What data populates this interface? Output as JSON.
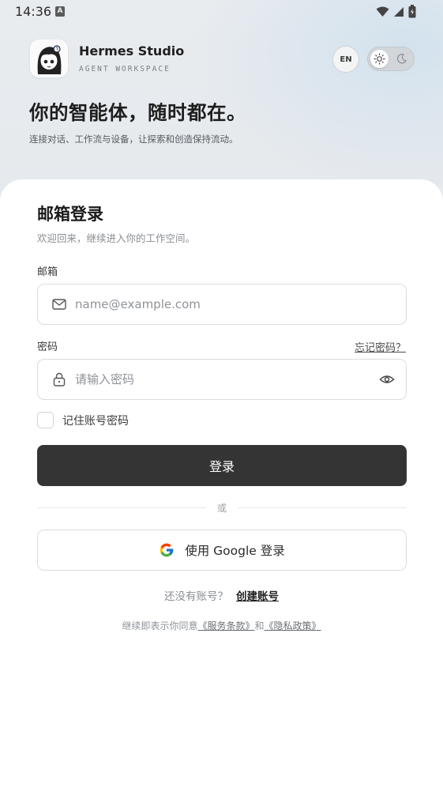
{
  "status_bar": {
    "time": "14:36",
    "notification_glyph": "A"
  },
  "brand": {
    "name": "Hermes Studio",
    "subtitle": "AGENT WORKSPACE"
  },
  "header": {
    "language_button": "EN"
  },
  "hero": {
    "title": "你的智能体，随时都在。",
    "subtitle": "连接对话、工作流与设备，让探索和创造保持流动。"
  },
  "login": {
    "title": "邮箱登录",
    "subtitle": "欢迎回来，继续进入你的工作空间。",
    "email_label": "邮箱",
    "email_placeholder": "name@example.com",
    "password_label": "密码",
    "forgot_password": "忘记密码？",
    "password_placeholder": "请输入密码",
    "remember_label": "记住账号密码",
    "submit_label": "登录",
    "divider_text": "或",
    "google_label": "使用 Google 登录",
    "no_account_text": "还没有账号？",
    "create_account": "创建账号",
    "terms_prefix": "继续即表示你同意",
    "terms_link": "《服务条款》",
    "terms_and": "和",
    "privacy_link": "《隐私政策》"
  },
  "icons": {
    "mail": "mail-icon",
    "lock": "lock-icon",
    "eye": "eye-icon",
    "google": "google-icon",
    "sun": "sun-icon",
    "moon": "moon-icon"
  },
  "colors": {
    "primary_button": "#343434",
    "background": "#e6e9ec",
    "card": "#ffffff"
  }
}
